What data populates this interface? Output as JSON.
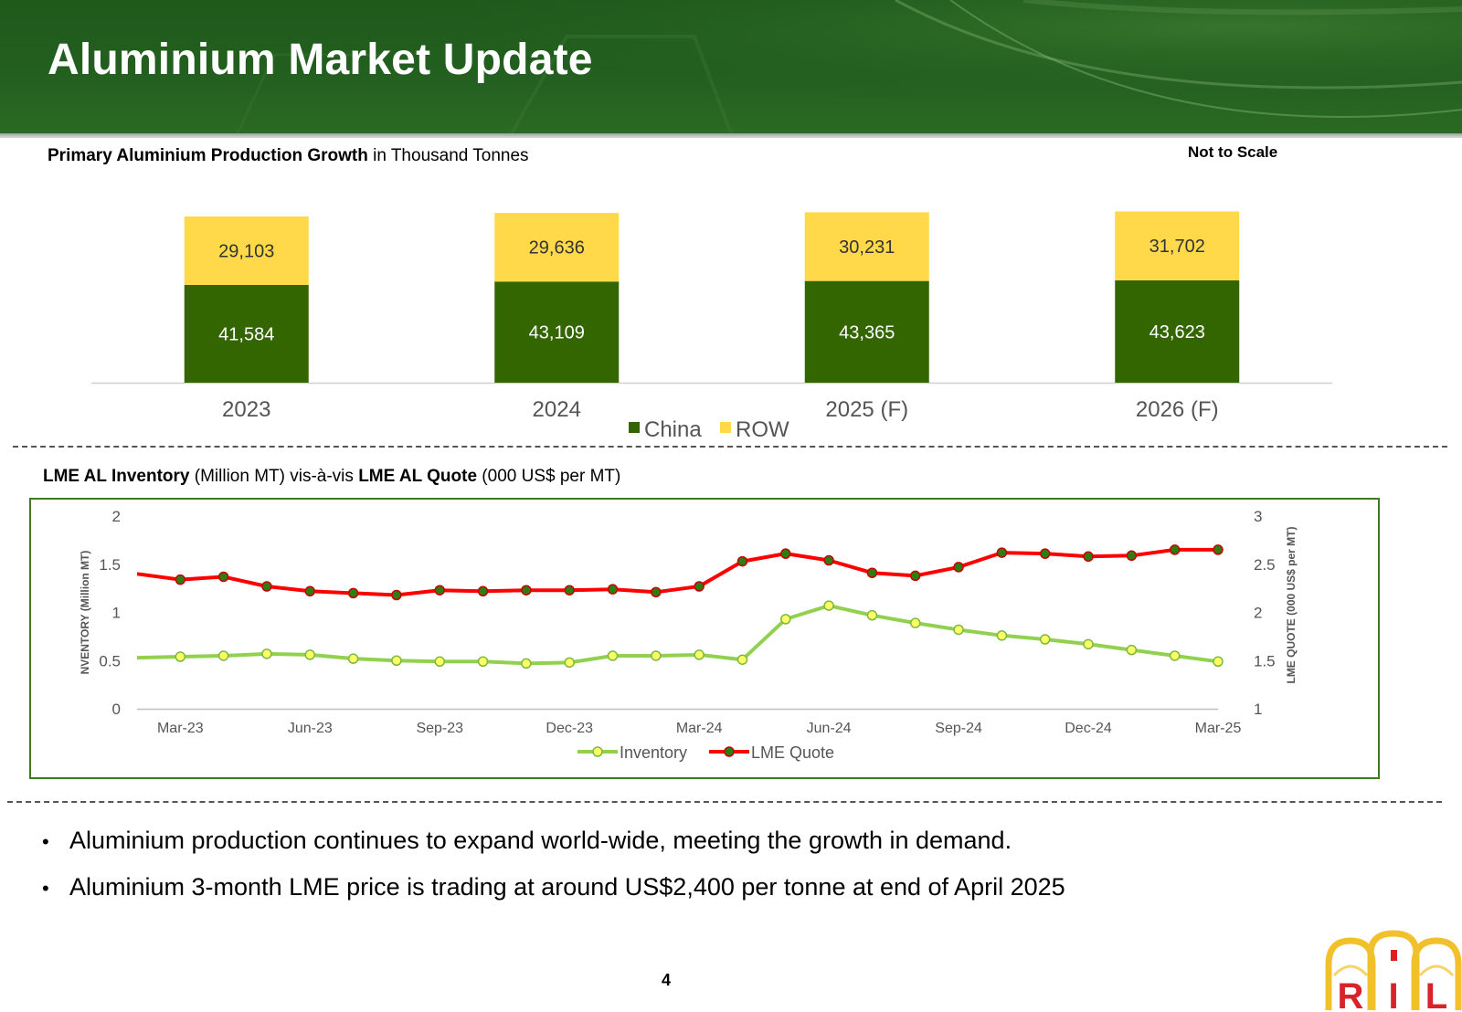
{
  "header": {
    "title": "Aluminium Market Update"
  },
  "bar_section": {
    "title_bold": "Primary Aluminium Production Growth",
    "title_rest": " in Thousand Tonnes",
    "note": "Not to Scale"
  },
  "line_section": {
    "title_bold1": "LME AL Inventory",
    "title_mid": " (Million MT) vis-à-vis ",
    "title_bold2": "LME AL Quote",
    "title_end": " (000 US$ per MT)"
  },
  "bullets": [
    "Aluminium production continues to expand world-wide, meeting the growth in demand.",
    "Aluminium 3-month LME price is trading at around US$2,400 per tonne at end of April 2025"
  ],
  "footer": {
    "page_number": "4",
    "logo_letters": [
      "R",
      "I",
      "L"
    ]
  },
  "chart_data": [
    {
      "type": "bar",
      "stacked": true,
      "categories": [
        "2023",
        "2024",
        "2025 (F)",
        "2026 (F)"
      ],
      "series": [
        {
          "name": "China",
          "values": [
            41584,
            43109,
            43365,
            43623
          ],
          "labels": [
            "41,584",
            "43,109",
            "43,365",
            "43,623"
          ],
          "color": "#336600"
        },
        {
          "name": "ROW",
          "values": [
            29103,
            29636,
            30231,
            31702
          ],
          "labels": [
            "29,103",
            "29,636",
            "30,231",
            "31,702"
          ],
          "color": "#ffd94a"
        }
      ],
      "legend_position": "bottom",
      "grid": false
    },
    {
      "type": "line",
      "x_ticks": [
        "Mar-23",
        "Jun-23",
        "Sep-23",
        "Dec-23",
        "Mar-24",
        "Jun-24",
        "Sep-24",
        "Dec-24",
        "Mar-25"
      ],
      "series": [
        {
          "name": "Inventory",
          "axis": "left",
          "color": "#92d050",
          "marker_color": "#ffff66",
          "values": [
            0.53,
            0.54,
            0.55,
            0.57,
            0.56,
            0.52,
            0.5,
            0.49,
            0.49,
            0.47,
            0.48,
            0.55,
            0.55,
            0.56,
            0.51,
            0.93,
            1.07,
            0.97,
            0.89,
            0.82,
            0.76,
            0.72,
            0.67,
            0.61,
            0.55,
            0.49
          ]
        },
        {
          "name": "LME Quote",
          "axis": "right",
          "color": "#ff0000",
          "marker_color": "#2e7d12",
          "values": [
            2.4,
            2.34,
            2.37,
            2.27,
            2.22,
            2.2,
            2.18,
            2.23,
            2.22,
            2.23,
            2.23,
            2.24,
            2.21,
            2.27,
            2.53,
            2.61,
            2.54,
            2.41,
            2.38,
            2.47,
            2.62,
            2.61,
            2.58,
            2.59,
            2.65,
            2.65
          ]
        }
      ],
      "y_left": {
        "label": "NVENTORY (Million MT)",
        "range": [
          0,
          2
        ],
        "ticks": [
          "0",
          "0.5",
          "1",
          "1.5",
          "2"
        ]
      },
      "y_right": {
        "label": "LME QUOTE (000 US$ per MT)",
        "range": [
          1,
          3
        ],
        "ticks": [
          "1",
          "1.5",
          "2",
          "2.5",
          "3"
        ]
      },
      "legend_position": "bottom",
      "grid": false
    }
  ]
}
